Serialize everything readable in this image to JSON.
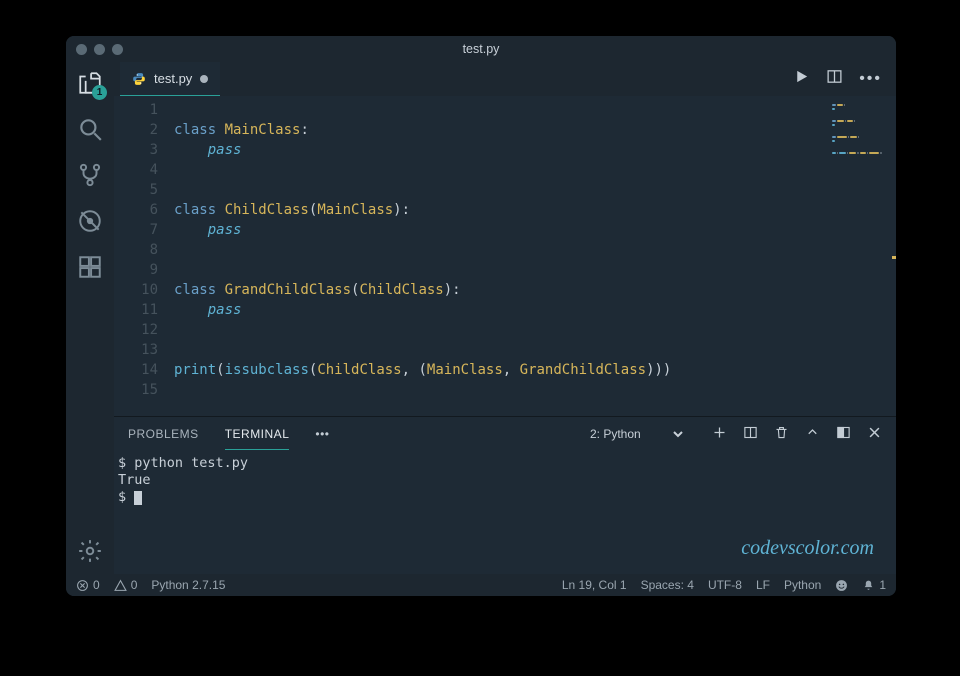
{
  "title": "test.py",
  "tab": {
    "label": "test.py",
    "modified": true
  },
  "activity": {
    "explorer_badge": "1"
  },
  "editor": {
    "line_numbers": [
      "1",
      "2",
      "3",
      "4",
      "5",
      "6",
      "7",
      "8",
      "9",
      "10",
      "11",
      "12",
      "13",
      "14",
      "15"
    ],
    "tokens": [
      [],
      [
        [
          "kw",
          "class "
        ],
        [
          "cls",
          "MainClass"
        ],
        [
          "pun",
          ":"
        ]
      ],
      [
        [
          "pun",
          "    "
        ],
        [
          "pass",
          "pass"
        ]
      ],
      [],
      [],
      [
        [
          "kw",
          "class "
        ],
        [
          "cls",
          "ChildClass"
        ],
        [
          "pun",
          "("
        ],
        [
          "cls",
          "MainClass"
        ],
        [
          "pun",
          "):"
        ]
      ],
      [
        [
          "pun",
          "    "
        ],
        [
          "pass",
          "pass"
        ]
      ],
      [],
      [],
      [
        [
          "kw",
          "class "
        ],
        [
          "cls",
          "GrandChildClass"
        ],
        [
          "pun",
          "("
        ],
        [
          "cls",
          "ChildClass"
        ],
        [
          "pun",
          "):"
        ]
      ],
      [
        [
          "pun",
          "    "
        ],
        [
          "pass",
          "pass"
        ]
      ],
      [],
      [],
      [
        [
          "fn",
          "print"
        ],
        [
          "pun",
          "("
        ],
        [
          "fn",
          "issubclass"
        ],
        [
          "pun",
          "("
        ],
        [
          "cls",
          "ChildClass"
        ],
        [
          "pun",
          ", ("
        ],
        [
          "cls",
          "MainClass"
        ],
        [
          "pun",
          ", "
        ],
        [
          "cls",
          "GrandChildClass"
        ],
        [
          "pun",
          ")))"
        ]
      ],
      []
    ]
  },
  "panel": {
    "tabs": {
      "problems": "PROBLEMS",
      "terminal": "TERMINAL"
    },
    "terminal_selector": "2: Python",
    "lines": [
      "$ python test.py",
      "True",
      "$ "
    ]
  },
  "watermark": "codevscolor.com",
  "status": {
    "errors": "0",
    "warnings": "0",
    "interpreter": "Python 2.7.15",
    "position": "Ln 19, Col 1",
    "spaces": "Spaces: 4",
    "encoding": "UTF-8",
    "eol": "LF",
    "lang": "Python",
    "notifications": "1"
  }
}
